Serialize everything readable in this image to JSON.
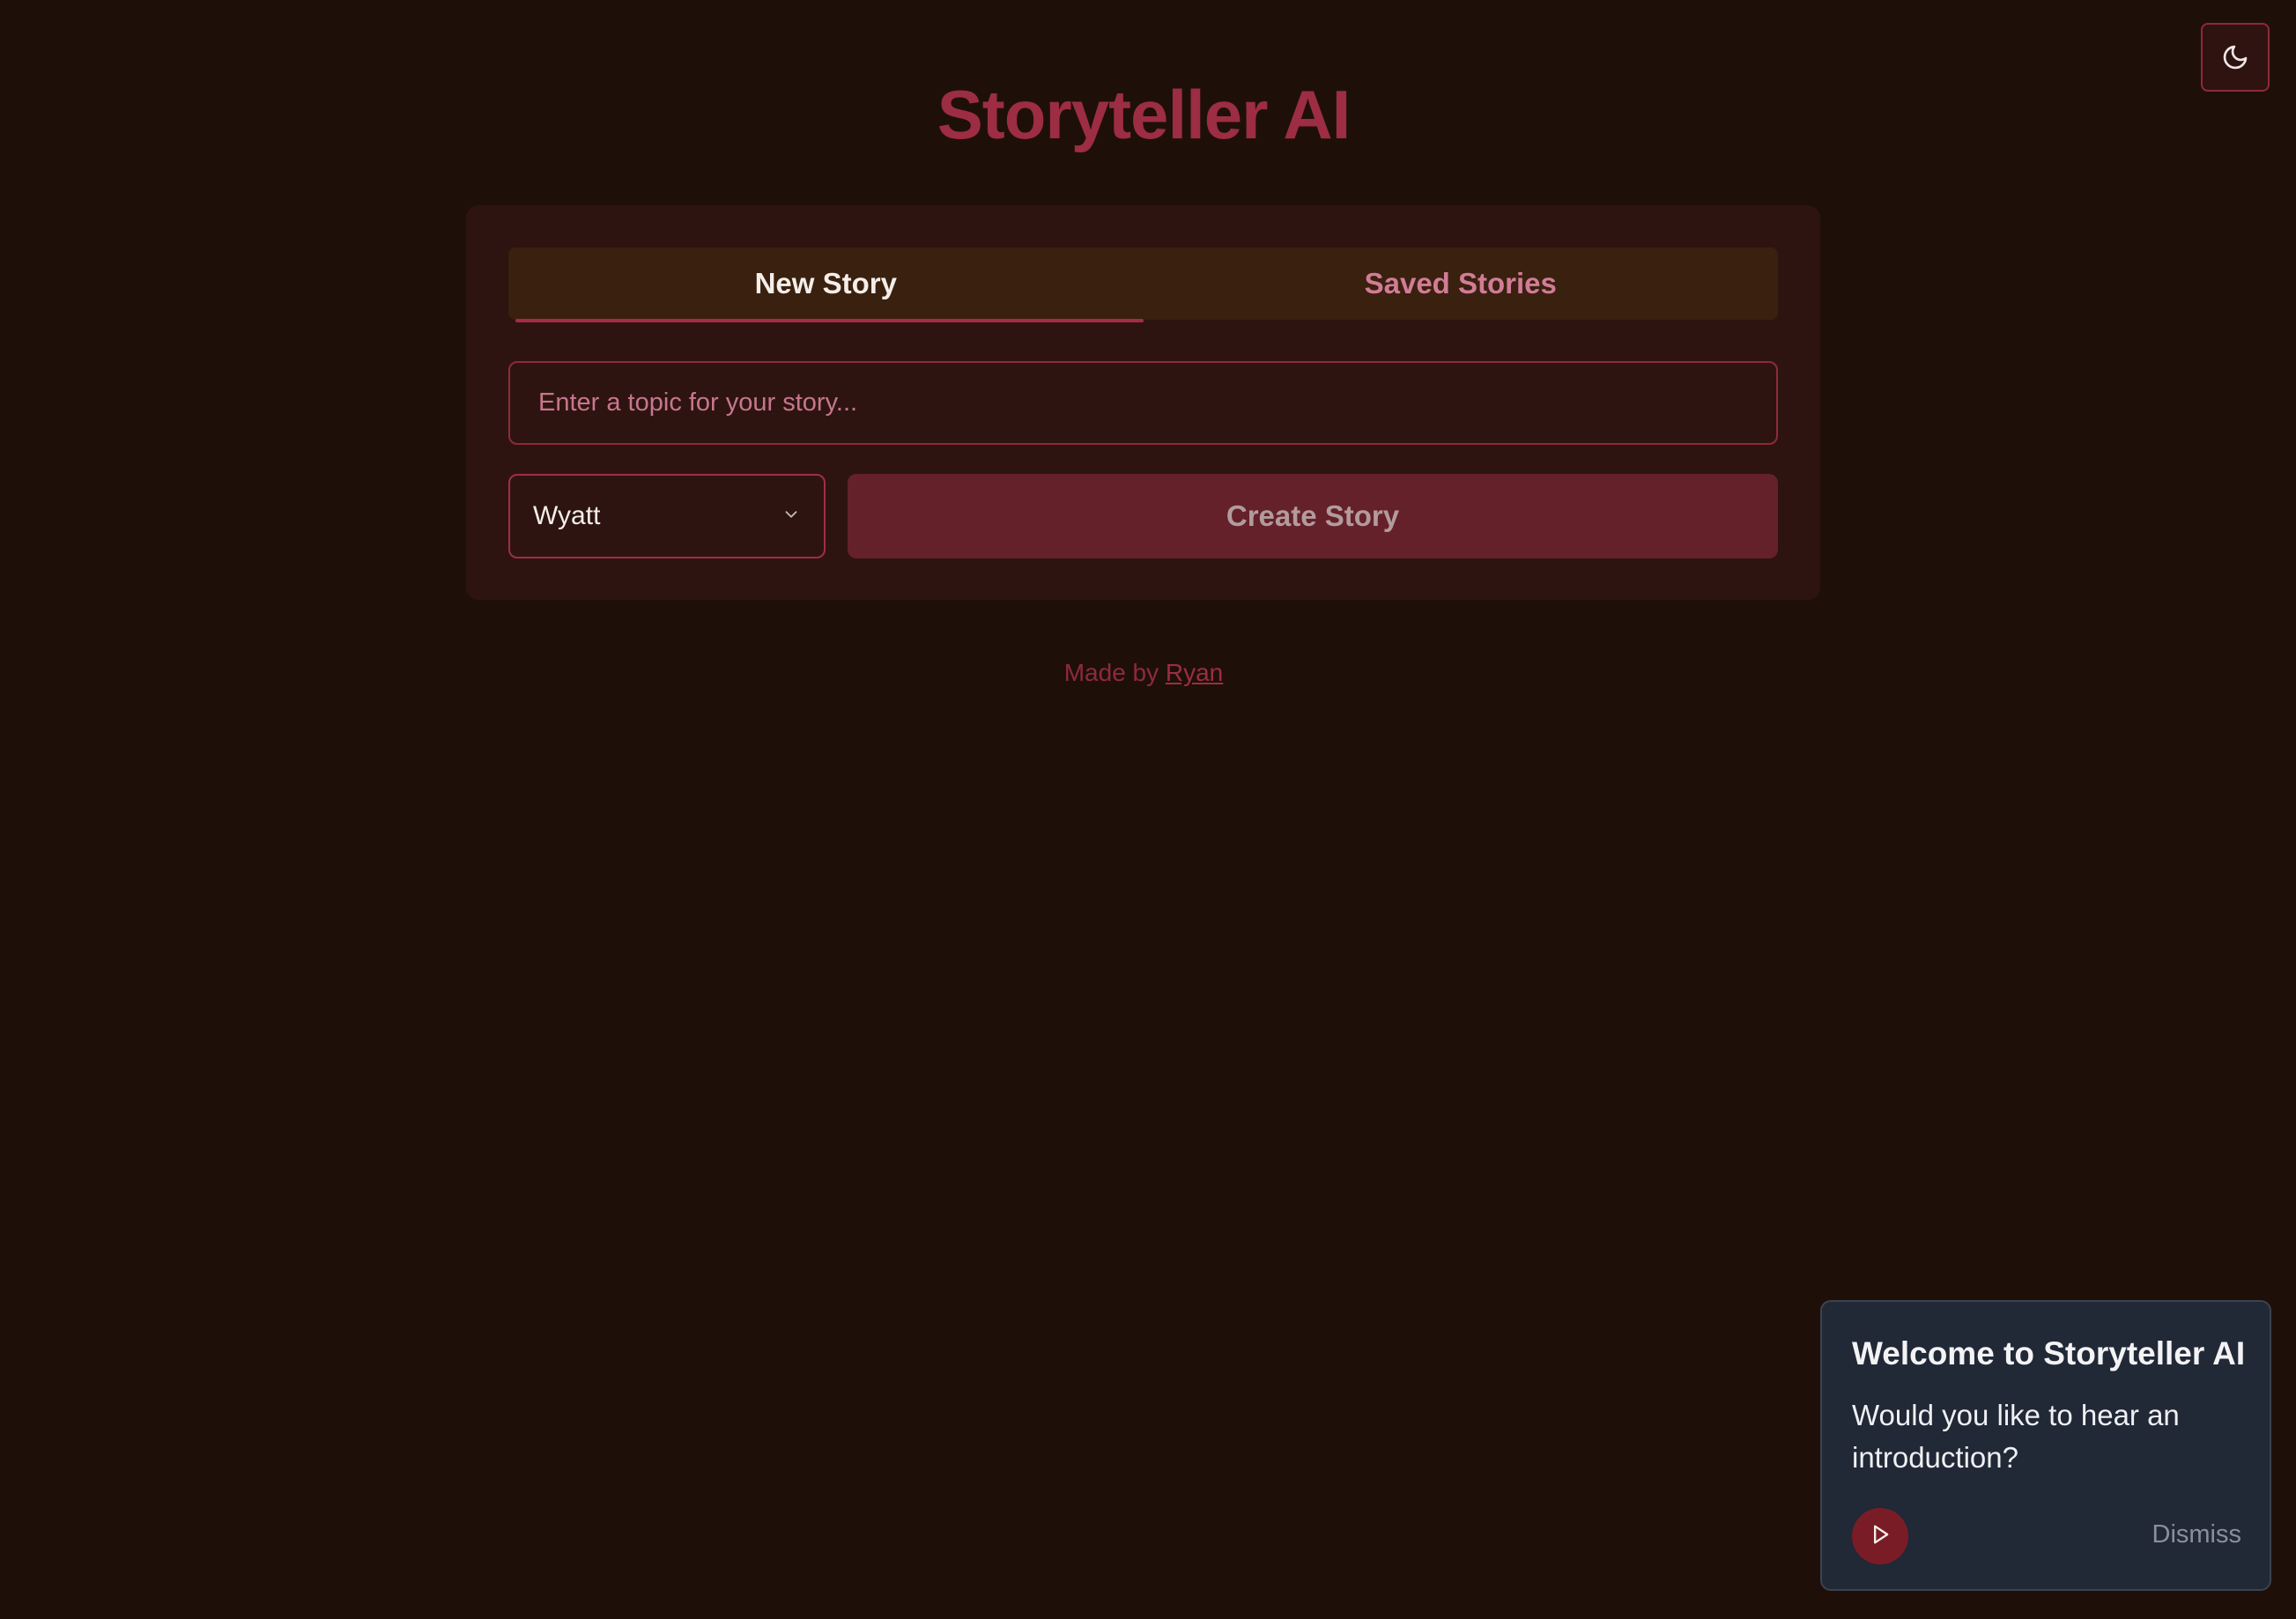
{
  "app": {
    "title": "Storyteller AI"
  },
  "theme_toggle": {
    "icon": "moon-icon"
  },
  "tabs": [
    {
      "label": "New Story",
      "active": true
    },
    {
      "label": "Saved Stories",
      "active": false
    }
  ],
  "story_form": {
    "topic_placeholder": "Enter a topic for your story...",
    "topic_value": "",
    "voice_selected": "Wyatt",
    "create_label": "Create Story"
  },
  "footer": {
    "prefix": "Made by ",
    "author_link": "Ryan"
  },
  "welcome_toast": {
    "title": "Welcome to Storyteller AI",
    "message": "Would you like to hear an introduction?",
    "play_icon": "play-icon",
    "dismiss_label": "Dismiss"
  },
  "colors": {
    "background": "#1e1009",
    "accent": "#9c2d42",
    "card": "#2e1410",
    "tab_bar": "#3a200e",
    "button": "#65212a",
    "toast": "#212836"
  }
}
